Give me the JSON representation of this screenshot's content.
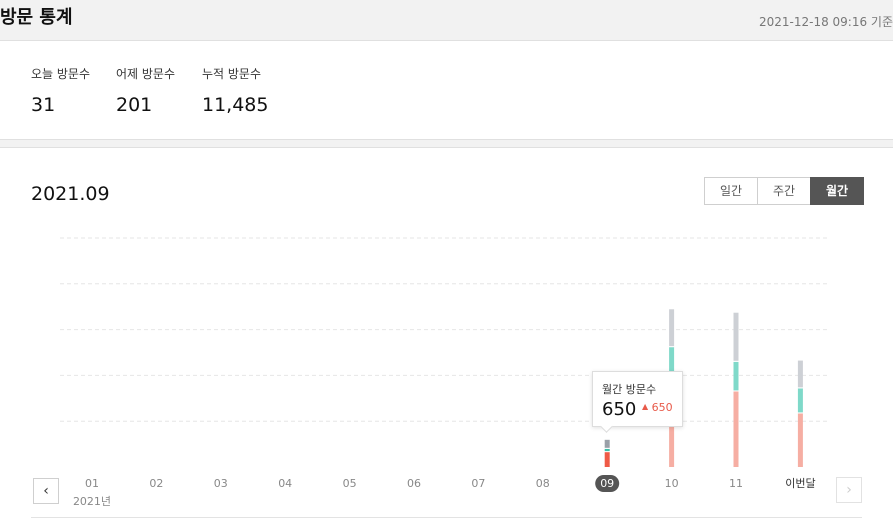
{
  "header": {
    "title": "방문 통계",
    "reference_time": "2021-12-18 09:16 기준"
  },
  "stats": [
    {
      "label": "오늘 방문수",
      "value": "31"
    },
    {
      "label": "어제 방문수",
      "value": "201"
    },
    {
      "label": "누적 방문수",
      "value": "11,485"
    }
  ],
  "period": {
    "title": "2021.09",
    "tabs": [
      {
        "label": "일간",
        "active": false
      },
      {
        "label": "주간",
        "active": false
      },
      {
        "label": "월간",
        "active": true
      }
    ]
  },
  "icons": {
    "prev": "chevron-left-icon",
    "next": "chevron-right-icon",
    "up": "triangle-up-icon"
  },
  "tooltip": {
    "label": "월간 방문수",
    "value": "650",
    "change": "650"
  },
  "colors": {
    "bar_selected_red": "#ef5a46",
    "bar_red": "#f6aea3",
    "bar_teal": "#7fd9c9",
    "bar_teal_selected": "#3cbfa8",
    "bar_gray": "#cdd0d5",
    "bar_gray_selected": "#9aa0a8",
    "selected_badge": "#555555",
    "accent_up": "#e85a4a"
  },
  "chart_data": {
    "type": "bar",
    "stacked": true,
    "categories": [
      "01",
      "02",
      "03",
      "04",
      "05",
      "06",
      "07",
      "08",
      "09",
      "10",
      "11",
      "이번달"
    ],
    "year_label": "2021년",
    "selected_index": 8,
    "series": [
      {
        "values": [
          0,
          0,
          0,
          0,
          0,
          0,
          0,
          0,
          650,
          3350,
          3300,
          2340
        ]
      },
      {
        "values": [
          0,
          0,
          0,
          0,
          0,
          0,
          0,
          0,
          100,
          1840,
          1250,
          1050
        ]
      },
      {
        "values": [
          0,
          0,
          0,
          0,
          0,
          0,
          0,
          0,
          350,
          1610,
          2100,
          1170
        ]
      }
    ],
    "ylim": [
      0,
      10000
    ],
    "grid": true
  }
}
